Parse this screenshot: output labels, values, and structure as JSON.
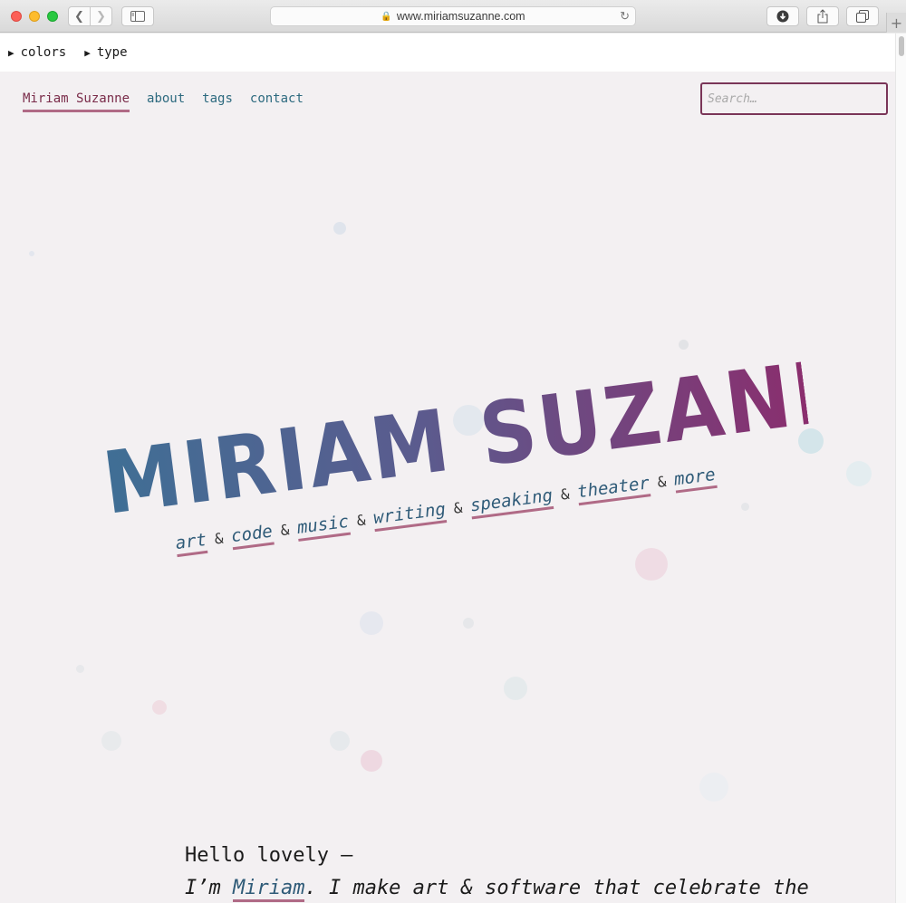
{
  "browser": {
    "url": "www.miriamsuzanne.com",
    "icons": {
      "back": "chevron-left-icon",
      "forward": "chevron-right-icon",
      "sidebar": "sidebar-icon",
      "lock": "lock-icon",
      "reload": "reload-icon",
      "downloads": "download-icon",
      "share": "share-icon",
      "tabs": "tabs-icon",
      "new_tab": "plus-icon"
    }
  },
  "toolbar": {
    "colors_label": "colors",
    "type_label": "type"
  },
  "nav": {
    "home": "Miriam Suzanne",
    "about": "about",
    "tags": "tags",
    "contact": "contact"
  },
  "search": {
    "placeholder": "Search…"
  },
  "hero": {
    "banner": "MIRIAM SUZANNE",
    "topics": [
      "art",
      "code",
      "music",
      "writing",
      "speaking",
      "theater",
      "more"
    ],
    "separator": "&"
  },
  "intro": {
    "greeting": "Hello lovely —",
    "line2_prefix": "I’m ",
    "name_link": "Miriam",
    "line2_suffix": ". I make art & software that celebrate the"
  },
  "colors": {
    "background": "#f3f0f2",
    "link": "#2d6a7f",
    "accent": "#7a2c4a",
    "underline": "#b06a86"
  }
}
